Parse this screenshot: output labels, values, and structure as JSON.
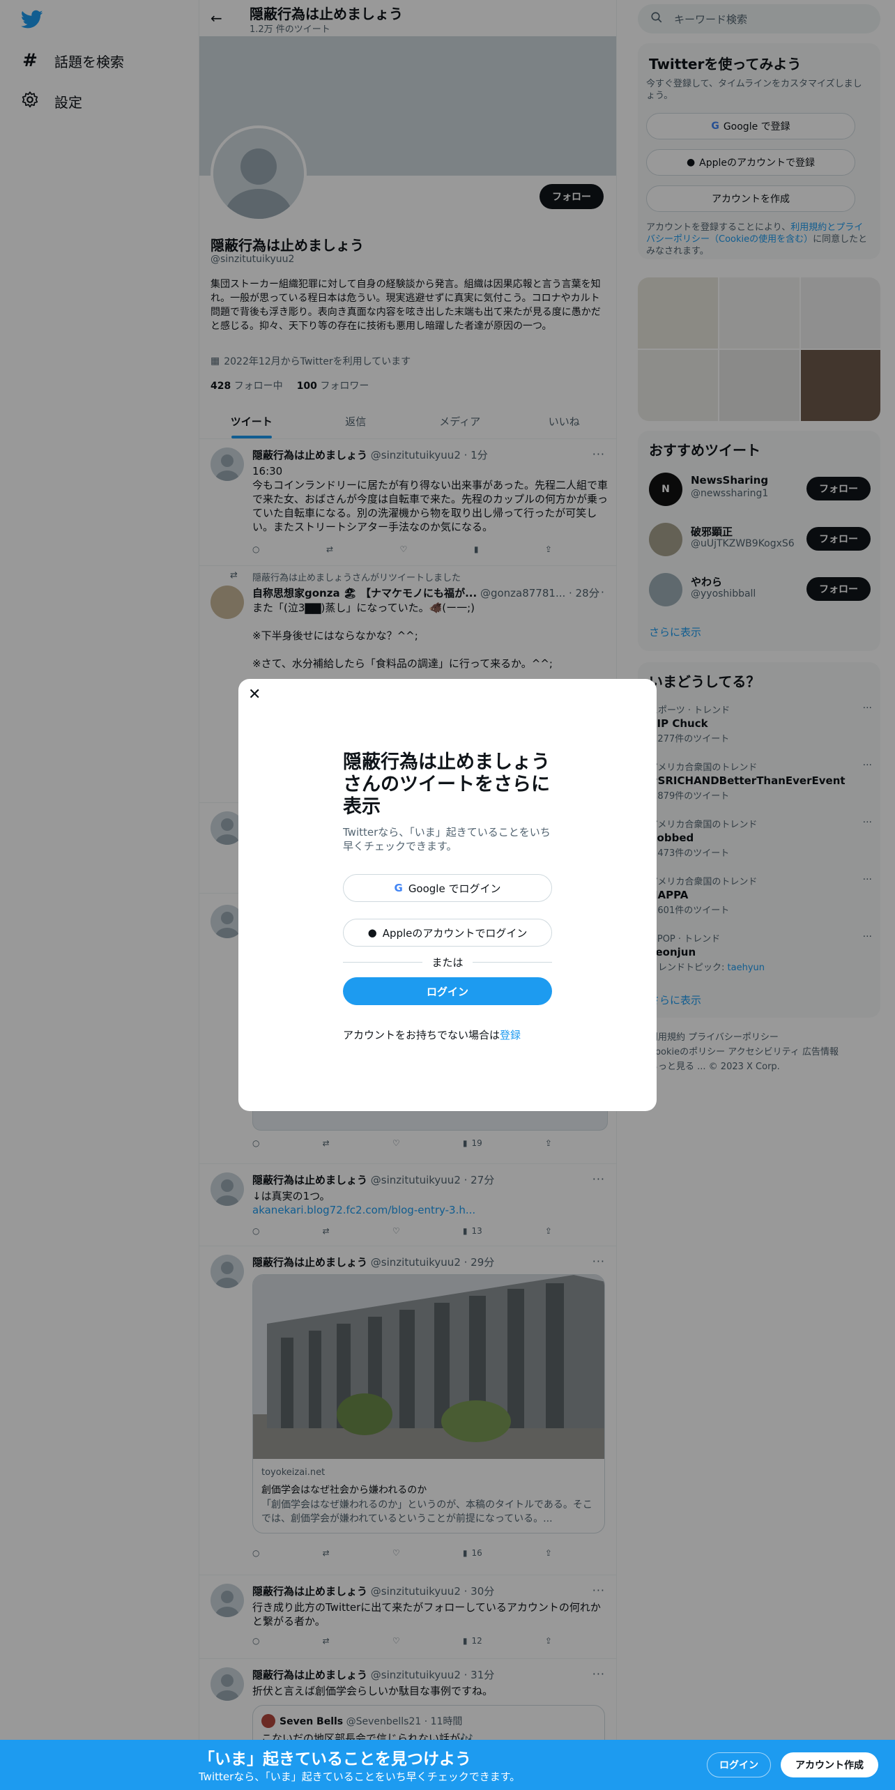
{
  "nav": {
    "explore_label": "話題を検索",
    "settings_label": "設定"
  },
  "header": {
    "title": "隠蔽行為は止めましょう",
    "tweet_count": "1.2万 件のツイート"
  },
  "profile": {
    "follow_label": "フォロー",
    "name": "隠蔽行為は止めましょう",
    "handle": "@sinzitutuikyuu2",
    "bio": "集団ストーカー組織犯罪に対して自身の経験談から発言。組織は因果応報と言う言葉を知れ。一般が思っている程日本は危うい。現実逃避せずに真実に気付こう。コロナやカルト問題で背後も浮き彫り。表向き真面な内容を呟き出した末端も出て来たが見る度に愚かだと感じる。抑々、天下り等の存在に技術も悪用し暗躍した者達が原因の一つ。",
    "joined": "2022年12月からTwitterを利用しています",
    "following_count": "428",
    "following_label": "フォロー中",
    "followers_count": "100",
    "followers_label": "フォロワー"
  },
  "tabs": [
    "ツイート",
    "返信",
    "メディア",
    "いいね"
  ],
  "tweets": [
    {
      "name": "隠蔽行為は止めましょう",
      "meta": "@sinzitutuikyuu2 · 1分",
      "text": "16:30\n今もコインランドリーに居たが有り得ない出来事があった。先程二人組で車で来た女、おばさんが今度は自転車で来た。先程のカップルの何方かが乗っていた自転車になる。別の洗濯機から物を取り出し帰って行ったが可笑しい。またストリートシアター手法なのか気になる。"
    },
    {
      "retweet_label": "隠蔽行為は止めましょうさんがリツイートしました",
      "name": "自称思想家gonza 🏖 【ナマケモノにも福が...",
      "meta": "@gonza87781... · 28分",
      "text": "また「(泣3▇▇)蒸し」になっていた。🐗(ー一;)\n\n※下半身後せにはならなかな？^^;\n\n※さて、水分補給したら「食料品の調達」に行って来るか。^^;"
    },
    {
      "views": "19"
    },
    {
      "name": "隠蔽行為は止めましょう",
      "meta": "@sinzitutuikyuu2 · 27分",
      "text": "↓は真実の1つ。",
      "link": "akanekari.blog72.fc2.com/blog-entry-3.h...",
      "views": "13"
    },
    {
      "name": "隠蔽行為は止めましょう",
      "meta": "@sinzitutuikyuu2 · 29分",
      "card_domain": "toyokeizai.net",
      "card_title": "創価学会はなぜ社会から嫌われるのか",
      "card_desc": "「創価学会はなぜ嫌われるのか」というのが、本稿のタイトルである。そこでは、創価学会が嫌われているということが前提になっている。...",
      "views": "16"
    },
    {
      "name": "隠蔽行為は止めましょう",
      "meta": "@sinzitutuikyuu2 · 30分",
      "text": "行き成り此方のTwitterに出て来たがフォローしているアカウントの何れかと繋がる者か。",
      "views": "12"
    },
    {
      "name": "隠蔽行為は止めましょう",
      "meta": "@sinzitutuikyuu2 · 31分",
      "text": "折伏と言えば創価学会らしいか駄目な事例ですね。",
      "quote_name": "Seven Bells",
      "quote_meta": "@Sevenbells21 · 11時間",
      "quote_text": "こないだの地区部長会で信じられない話が🎶"
    }
  ],
  "search": {
    "placeholder": "キーワード検索"
  },
  "signup": {
    "title": "Twitterを使ってみよう",
    "subtitle": "今すぐ登録して、タイムラインをカスタマイズしましょう。",
    "google": "Google で登録",
    "apple": "Appleのアカウントで登録",
    "create": "アカウントを作成",
    "legal_pre": "アカウントを登録することにより、",
    "legal_link": "利用規約とプライバシーポリシー（Cookieの使用を含む）",
    "legal_post": "に同意したとみなされます。"
  },
  "recommended": {
    "title": "おすすめツイート",
    "items": [
      {
        "name": "NewsSharing",
        "handle": "@newssharing1",
        "follow": "フォロー"
      },
      {
        "name": "破邪顕正",
        "handle": "@uUjTKZWB9KogxS6",
        "follow": "フォロー"
      },
      {
        "name": "やわら",
        "handle": "@yyoshibball",
        "follow": "フォロー"
      }
    ],
    "more": "さらに表示"
  },
  "trends": {
    "title": "いまどうしてる？",
    "items": [
      {
        "cat": "スポーツ · トレンド",
        "name": "RIP Chuck",
        "count": "2,277件のツイート"
      },
      {
        "cat": "アメリカ合衆国のトレンド",
        "name": "#SRICHANDBetterThanEverEvent",
        "count": "3,879件のツイート"
      },
      {
        "cat": "アメリカ合衆国のトレンド",
        "name": "Robbed",
        "count": "9,473件のツイート"
      },
      {
        "cat": "アメリカ合衆国のトレンド",
        "name": "HAPPA",
        "count": "4,601件のツイート"
      },
      {
        "cat": "K-POP · トレンド",
        "name": "Yeonjun",
        "count": "トレンドトピック: ",
        "topic": "taehyun"
      }
    ],
    "more": "さらに表示"
  },
  "footer": {
    "line1": "利用規約  プライバシーポリシー",
    "line2": "Cookieのポリシー  アクセシビリティ  広告情報",
    "line3": "もっと見る ...  © 2023 X Corp."
  },
  "modal": {
    "title": "隠蔽行為は止めましょうさんのツイートをさらに表示",
    "subtitle": "Twitterなら、「いま」起きていることをいち早くチェックできます。",
    "google": "Google でログイン",
    "apple": "Appleのアカウントでログイン",
    "or": "または",
    "login": "ログイン",
    "noaccount": "アカウントをお持ちでない場合は",
    "register": "登録"
  },
  "bottombar": {
    "title": "「いま」起きていることを見つけよう",
    "subtitle": "Twitterなら、「いま」起きていることをいち早くチェックできます。",
    "login": "ログイン",
    "signup": "アカウント作成"
  },
  "colors": {
    "accent": "#1d9bf0",
    "dark": "#0f1419"
  }
}
